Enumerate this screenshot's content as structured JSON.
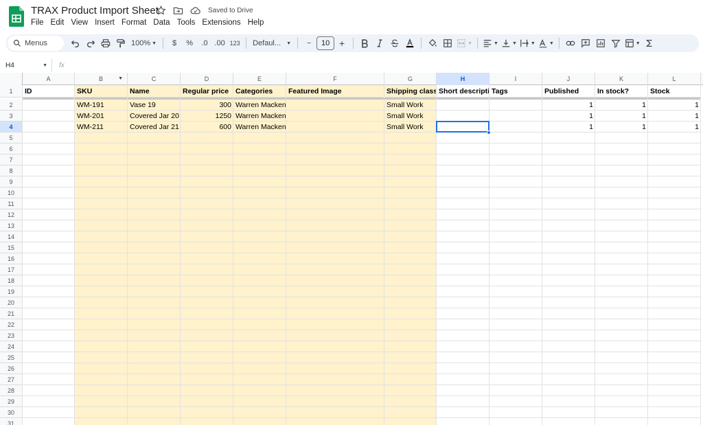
{
  "app": {
    "title": "TRAX Product Import Sheet",
    "saved_status": "Saved to Drive",
    "menu": [
      "File",
      "Edit",
      "View",
      "Insert",
      "Format",
      "Data",
      "Tools",
      "Extensions",
      "Help"
    ]
  },
  "toolbar": {
    "search_label": "Menus",
    "zoom": "100%",
    "currency": "$",
    "percent": "%",
    "decrease_decimal": ".0",
    "increase_decimal": ".00",
    "number_format": "123",
    "font": "Defaul...",
    "font_size": "10",
    "minus": "−",
    "plus": "+"
  },
  "formula_bar": {
    "name_box": "H4",
    "fx": "fx",
    "value": ""
  },
  "colors": {
    "highlight": "#fff2cc",
    "selection": "#1a73e8",
    "active_header": "#d3e3fd"
  },
  "sheet": {
    "columns": [
      "A",
      "B",
      "C",
      "D",
      "E",
      "F",
      "G",
      "H",
      "I",
      "J",
      "K",
      "L"
    ],
    "row_numbers": [
      "1",
      "2",
      "3",
      "4",
      "5",
      "6",
      "7",
      "8",
      "9",
      "10",
      "11",
      "12",
      "13",
      "14",
      "15",
      "16",
      "17",
      "18",
      "19",
      "20",
      "21",
      "22",
      "23",
      "24",
      "25",
      "26",
      "27",
      "28",
      "29",
      "30",
      "31"
    ],
    "active_cell": "H4",
    "header": [
      "ID",
      "SKU",
      "Name",
      "Regular price",
      "Categories",
      "Featured Image",
      "Shipping class",
      "Short description",
      "Tags",
      "Published",
      "In stock?",
      "Stock"
    ],
    "rows": [
      [
        "",
        "WM-191",
        "Vase 19",
        "300",
        "Warren Mackenzie",
        "",
        "Small Work",
        "",
        "",
        "1",
        "1",
        "1"
      ],
      [
        "",
        "WM-201",
        "Covered Jar 20",
        "1250",
        "Warren Mackenzie",
        "",
        "Small Work",
        "",
        "",
        "1",
        "1",
        "1"
      ],
      [
        "",
        "WM-211",
        "Covered Jar 21",
        "600",
        "Warren Mackenzie",
        "",
        "Small Work",
        "",
        "",
        "1",
        "1",
        "1"
      ]
    ]
  }
}
